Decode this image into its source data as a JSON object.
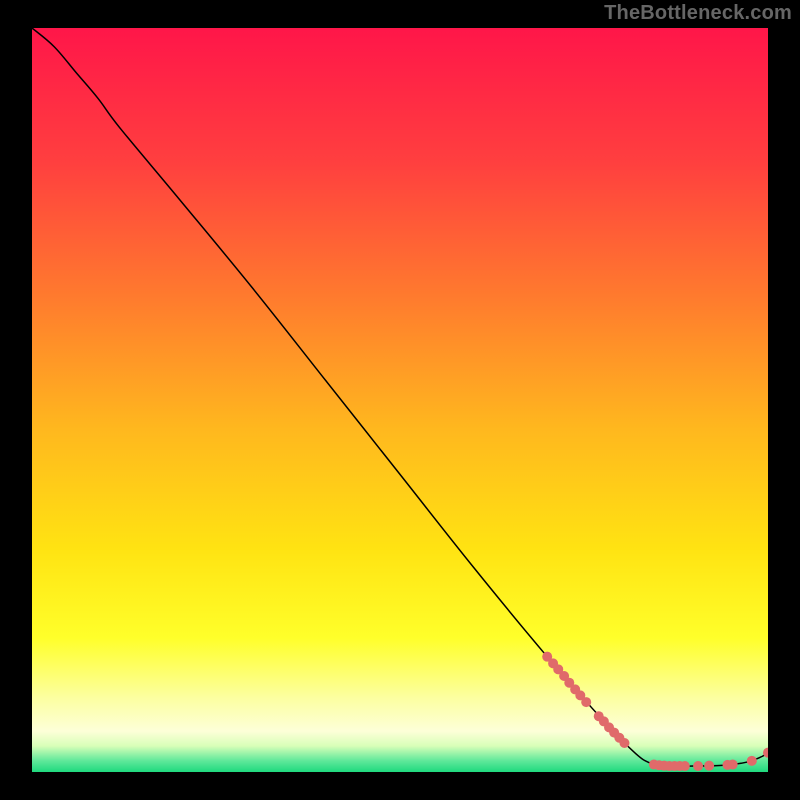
{
  "attribution": "TheBottleneck.com",
  "chart_data": {
    "type": "line",
    "title": "",
    "xlabel": "",
    "ylabel": "",
    "xlim": [
      0,
      100
    ],
    "ylim": [
      0,
      100
    ],
    "grid": false,
    "legend": false,
    "background_gradient_stops": [
      {
        "offset": 0.0,
        "color": "#ff1649"
      },
      {
        "offset": 0.18,
        "color": "#ff3f3f"
      },
      {
        "offset": 0.36,
        "color": "#ff7a2e"
      },
      {
        "offset": 0.54,
        "color": "#ffb81e"
      },
      {
        "offset": 0.7,
        "color": "#ffe312"
      },
      {
        "offset": 0.82,
        "color": "#ffff2a"
      },
      {
        "offset": 0.9,
        "color": "#fcffa0"
      },
      {
        "offset": 0.945,
        "color": "#fdffd8"
      },
      {
        "offset": 0.965,
        "color": "#d8ffb8"
      },
      {
        "offset": 0.985,
        "color": "#5fe89a"
      },
      {
        "offset": 1.0,
        "color": "#1fd97e"
      }
    ],
    "series": [
      {
        "name": "bottleneck-curve",
        "stroke": "#000000",
        "stroke_width": 1.5,
        "points": [
          {
            "x": 0.0,
            "y": 100.0
          },
          {
            "x": 3.0,
            "y": 97.5
          },
          {
            "x": 6.0,
            "y": 94.0
          },
          {
            "x": 9.0,
            "y": 90.5
          },
          {
            "x": 12.0,
            "y": 86.5
          },
          {
            "x": 20.0,
            "y": 77.0
          },
          {
            "x": 30.0,
            "y": 65.0
          },
          {
            "x": 40.0,
            "y": 52.5
          },
          {
            "x": 50.0,
            "y": 40.0
          },
          {
            "x": 60.0,
            "y": 27.5
          },
          {
            "x": 70.0,
            "y": 15.5
          },
          {
            "x": 78.0,
            "y": 6.5
          },
          {
            "x": 82.0,
            "y": 2.5
          },
          {
            "x": 84.0,
            "y": 1.2
          },
          {
            "x": 86.0,
            "y": 0.8
          },
          {
            "x": 90.0,
            "y": 0.8
          },
          {
            "x": 94.0,
            "y": 0.9
          },
          {
            "x": 97.0,
            "y": 1.3
          },
          {
            "x": 99.0,
            "y": 2.0
          },
          {
            "x": 100.0,
            "y": 2.6
          }
        ]
      }
    ],
    "markers": {
      "name": "highlighted-samples",
      "fill": "#e06a6a",
      "radius": 5,
      "points": [
        {
          "x": 70.0,
          "y": 15.5
        },
        {
          "x": 70.8,
          "y": 14.6
        },
        {
          "x": 71.5,
          "y": 13.8
        },
        {
          "x": 72.3,
          "y": 12.9
        },
        {
          "x": 73.0,
          "y": 12.0
        },
        {
          "x": 73.8,
          "y": 11.1
        },
        {
          "x": 74.5,
          "y": 10.3
        },
        {
          "x": 75.3,
          "y": 9.4
        },
        {
          "x": 77.0,
          "y": 7.5
        },
        {
          "x": 77.7,
          "y": 6.8
        },
        {
          "x": 78.4,
          "y": 6.0
        },
        {
          "x": 79.1,
          "y": 5.3
        },
        {
          "x": 79.8,
          "y": 4.6
        },
        {
          "x": 80.5,
          "y": 3.9
        },
        {
          "x": 84.5,
          "y": 1.0
        },
        {
          "x": 85.2,
          "y": 0.9
        },
        {
          "x": 85.9,
          "y": 0.85
        },
        {
          "x": 86.6,
          "y": 0.8
        },
        {
          "x": 87.3,
          "y": 0.8
        },
        {
          "x": 88.0,
          "y": 0.8
        },
        {
          "x": 88.7,
          "y": 0.8
        },
        {
          "x": 90.5,
          "y": 0.8
        },
        {
          "x": 92.0,
          "y": 0.85
        },
        {
          "x": 94.5,
          "y": 0.95
        },
        {
          "x": 95.2,
          "y": 1.0
        },
        {
          "x": 97.8,
          "y": 1.5
        },
        {
          "x": 100.0,
          "y": 2.6
        }
      ]
    }
  }
}
